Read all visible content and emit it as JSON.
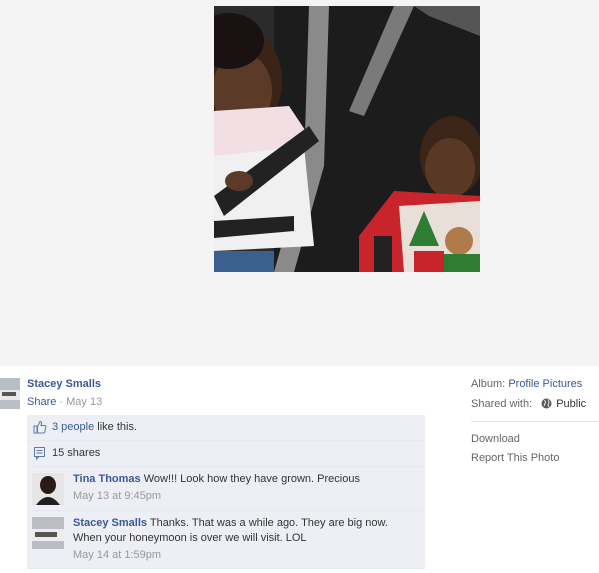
{
  "post": {
    "author": "Stacey Smalls",
    "share_label": "Share",
    "separator": " · ",
    "date": "May 13"
  },
  "feedback": {
    "likes_count_text": "3 people",
    "likes_suffix": " like this.",
    "shares_text": "15 shares"
  },
  "comments": [
    {
      "author": "Tina Thomas",
      "text": " Wow!!! Look how they have grown. Precious",
      "time": "May 13 at 9:45pm"
    },
    {
      "author": "Stacey Smalls",
      "text": " Thanks. That was a while ago. They are big now. When your honeymoon is over we will visit. LOL",
      "time": "May 14 at 1:59pm"
    }
  ],
  "sidebar": {
    "album_label": "Album:",
    "album_name": "Profile Pictures",
    "shared_with_label": "Shared with:",
    "audience": "Public",
    "download_label": "Download",
    "report_label": "Report This Photo"
  },
  "colors": {
    "link": "#3b5998",
    "ufi_background": "#edeff4",
    "stage_background": "#f4f4f4"
  },
  "icons": {
    "like": "thumbs-up-icon",
    "shares": "share-icon",
    "audience": "globe-icon"
  }
}
